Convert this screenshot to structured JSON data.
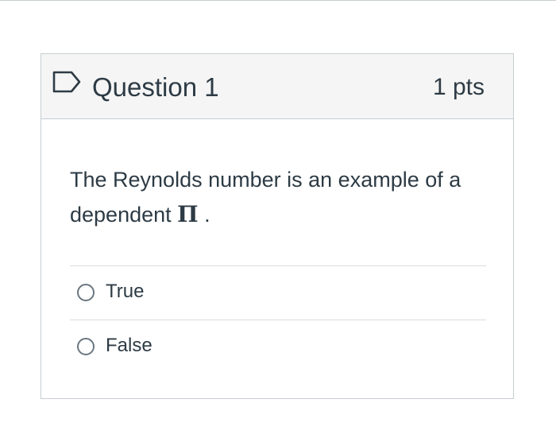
{
  "question": {
    "title": "Question 1",
    "points": "1 pts",
    "text_before": "The Reynolds number is an example of a dependent ",
    "symbol": "Π",
    "text_after": " .",
    "answers": [
      {
        "label": "True",
        "selected": false
      },
      {
        "label": "False",
        "selected": false
      }
    ]
  },
  "colors": {
    "header_bg": "#f5f5f5",
    "border": "#c7cdd1",
    "text": "#2d3b45"
  },
  "icons": {
    "flag": "flag-question-icon",
    "radio": "radio-unselected-icon"
  }
}
